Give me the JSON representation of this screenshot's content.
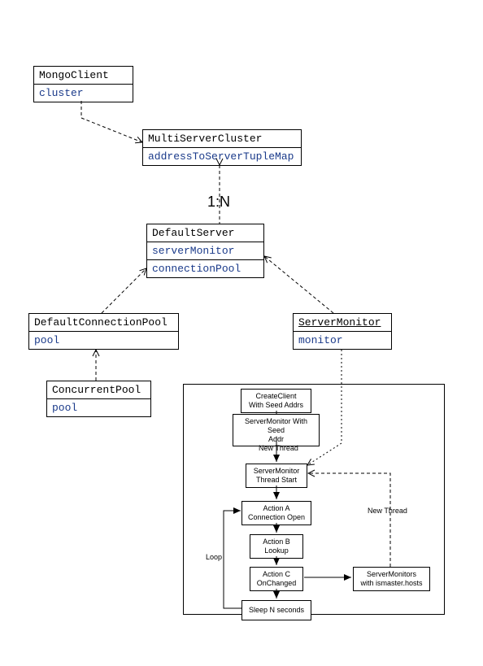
{
  "classes": {
    "mongoClient": {
      "title": "MongoClient",
      "attr1": "cluster"
    },
    "multiServerCluster": {
      "title": "MultiServerCluster",
      "attr1": "addressToServerTupleMap"
    },
    "defaultServer": {
      "title": "DefaultServer",
      "attr1": "serverMonitor",
      "attr2": "connectionPool"
    },
    "defaultConnectionPool": {
      "title": "DefaultConnectionPool",
      "attr1": "pool"
    },
    "serverMonitor": {
      "title": "ServerMonitor",
      "attr1": "monitor"
    },
    "concurrentPool": {
      "title": "ConcurrentPool",
      "attr1": "pool"
    }
  },
  "labels": {
    "ratio": "1:N",
    "newThread1": "New Thread",
    "newThread2": "New Thread",
    "loop": "Loop"
  },
  "flow": {
    "createClient": {
      "l1": "CreateClient",
      "l2": "With Seed Addrs"
    },
    "serverMonitorSeed": {
      "l1": "ServerMonitor With Seed",
      "l2": "Addr"
    },
    "threadStart": {
      "l1": "ServerMonitor",
      "l2": "Thread Start"
    },
    "actionA": {
      "l1": "Action A",
      "l2": "Connection Open"
    },
    "actionB": {
      "l1": "Action B",
      "l2": "Lookup"
    },
    "actionC": {
      "l1": "Action C",
      "l2": "OnChanged"
    },
    "sleep": {
      "l1": "Sleep N seconds"
    },
    "serverMonitors": {
      "l1": "ServerMonitors",
      "l2": "with ismaster.hosts"
    }
  }
}
